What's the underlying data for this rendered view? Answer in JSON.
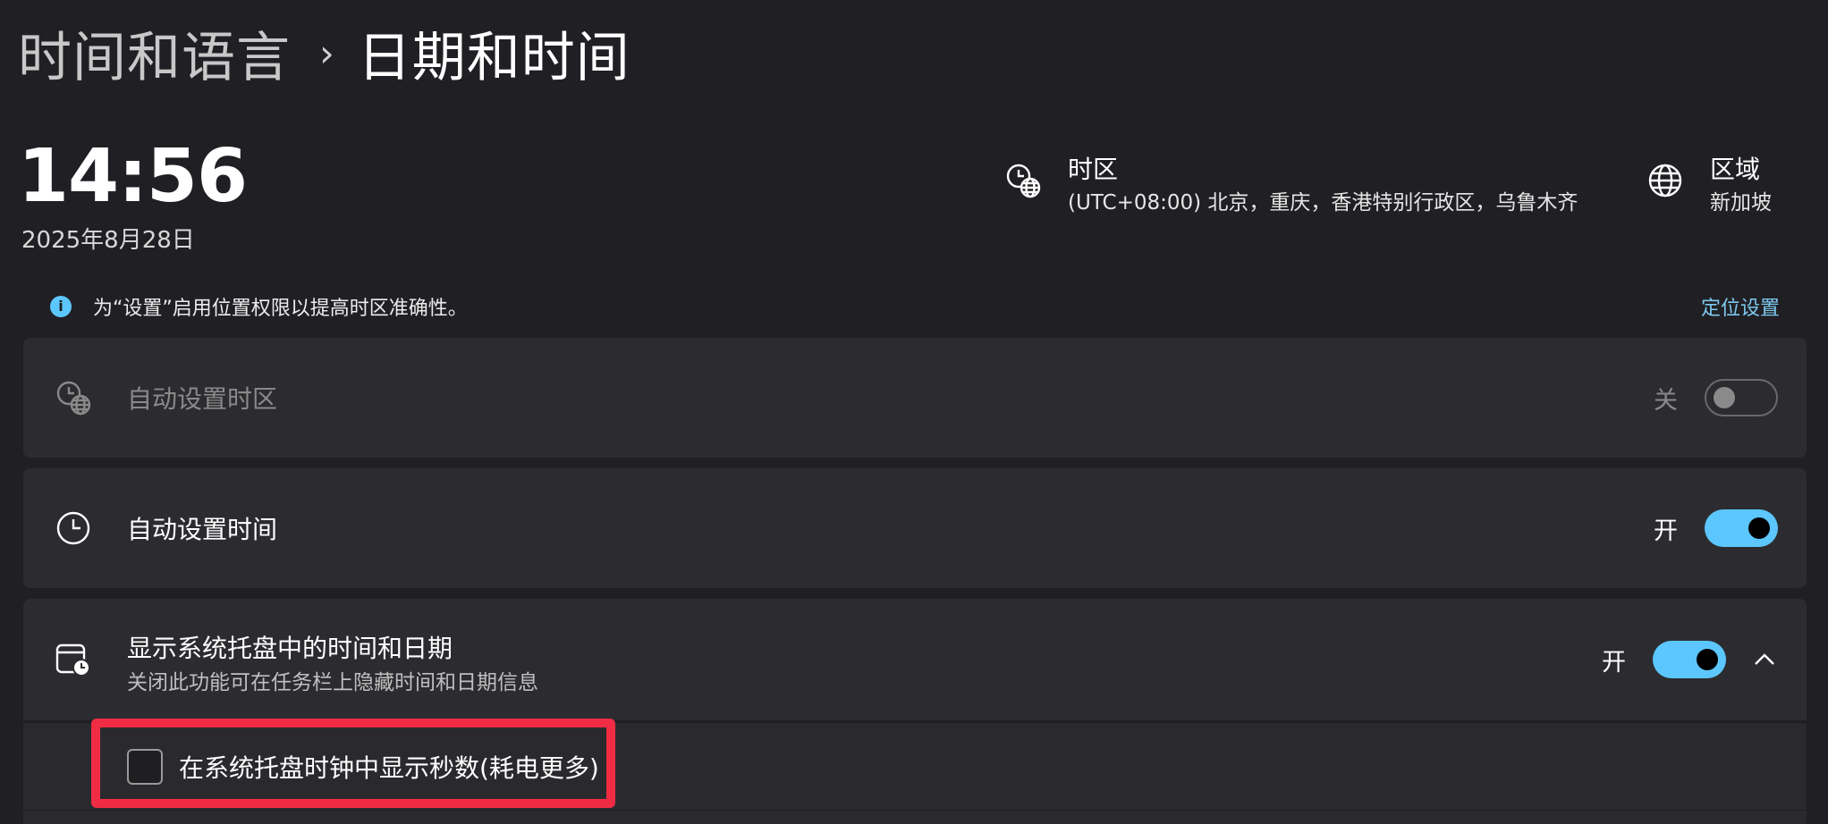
{
  "breadcrumb": {
    "parent": "时间和语言",
    "separator": "›",
    "current": "日期和时间"
  },
  "clock": {
    "time": "14:56",
    "date": "2025年8月28日"
  },
  "timezone": {
    "title": "时区",
    "value": "(UTC+08:00) 北京，重庆，香港特别行政区，乌鲁木齐",
    "icon": "clock-globe-icon"
  },
  "region": {
    "title": "区域",
    "value": "新加坡",
    "icon": "globe-icon"
  },
  "info": {
    "icon": "info-icon",
    "icon_glyph": "i",
    "text": "为“设置”启用位置权限以提高时区准确性。",
    "link": "定位设置"
  },
  "settings": {
    "auto_timezone": {
      "label": "自动设置时区",
      "state": "关",
      "on": false,
      "enabled": false,
      "icon": "clock-globe-icon"
    },
    "auto_time": {
      "label": "自动设置时间",
      "state": "开",
      "on": true,
      "enabled": true,
      "icon": "clock-icon"
    },
    "tray_time": {
      "label": "显示系统托盘中的时间和日期",
      "sub": "关闭此功能可在任务栏上隐藏时间和日期信息",
      "state": "开",
      "on": true,
      "expanded": true,
      "icon": "calendar-clock-icon"
    },
    "show_seconds": {
      "label": "在系统托盘时钟中显示秒数(耗电更多)",
      "checked": false
    }
  },
  "colors": {
    "accent": "#5cc7ff",
    "highlight": "#f02c44",
    "background": "#202024",
    "card": "#2c2c30"
  }
}
